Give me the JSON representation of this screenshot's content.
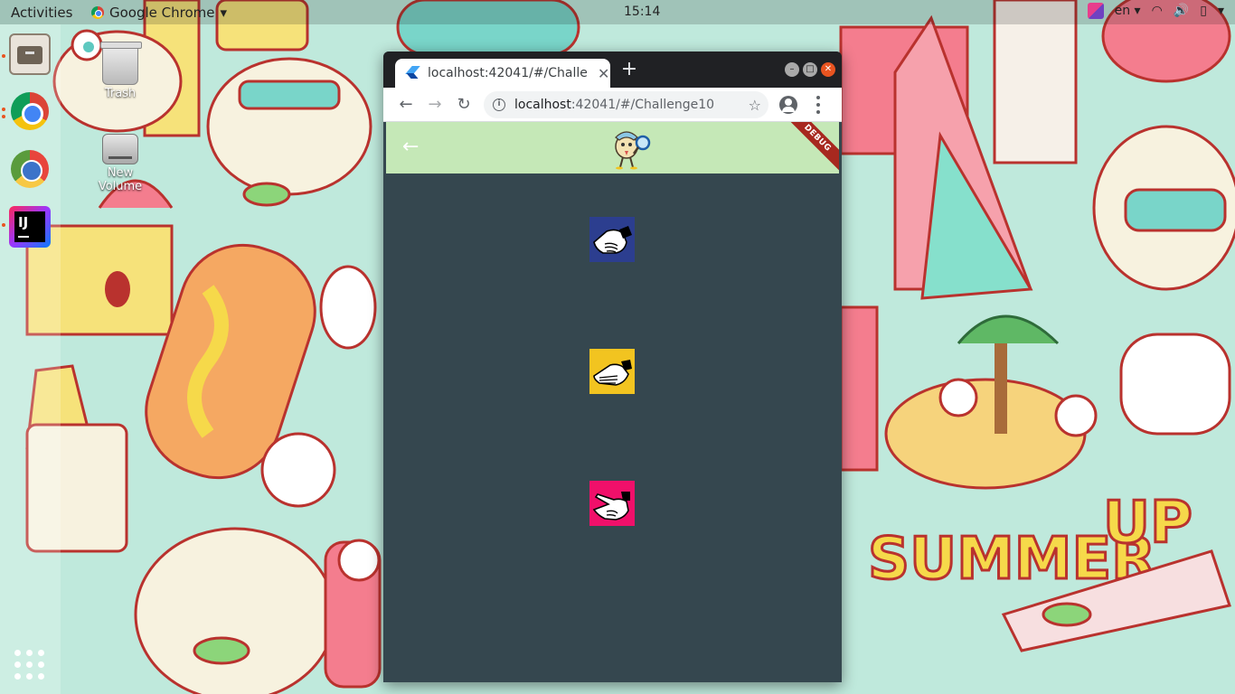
{
  "topbar": {
    "activities": "Activities",
    "app_name": "Google Chrome",
    "clock": "15:14",
    "language": "en"
  },
  "desktop": {
    "trash_label": "Trash",
    "volume_label": "New Volume"
  },
  "browser": {
    "tab_title": "localhost:42041/#/Challe",
    "url_host": "localhost",
    "url_path": ":42041/#/Challenge10"
  },
  "app": {
    "debug_label": "DEBUG",
    "choices": [
      {
        "name": "rock",
        "color": "#2c3e8f"
      },
      {
        "name": "paper",
        "color": "#f2c420"
      },
      {
        "name": "scissors",
        "color": "#f0106a"
      }
    ]
  },
  "colors": {
    "appbar": "#c5e8b7",
    "body": "#35474f",
    "debug": "#a7281f"
  }
}
